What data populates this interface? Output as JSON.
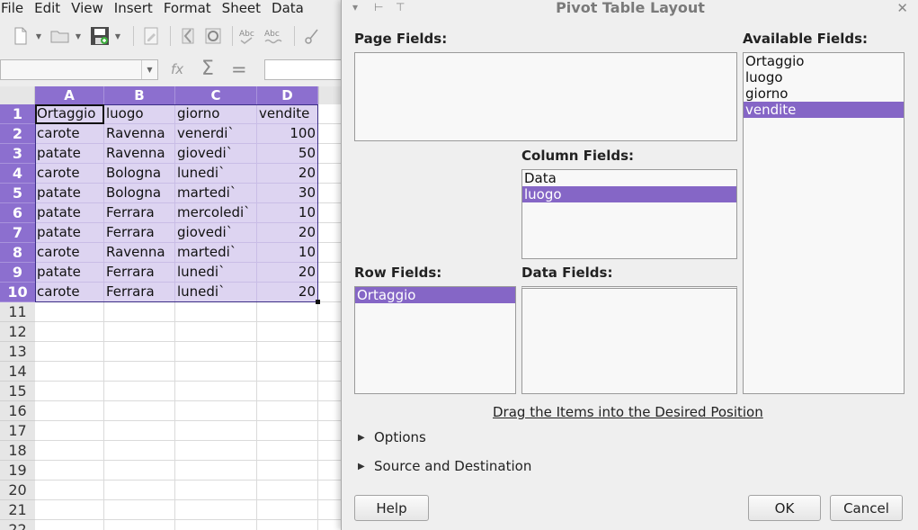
{
  "menubar": {
    "items": [
      "File",
      "Edit",
      "View",
      "Insert",
      "Format",
      "Sheet",
      "Data"
    ]
  },
  "toolbar": {
    "icons": [
      "new-document-icon",
      "open-folder-icon",
      "save-icon",
      "edit-file-icon",
      "export-pdf-icon",
      "print-preview-icon",
      "spellcheck-icon",
      "autospell-icon",
      "cut-icon"
    ]
  },
  "formula_bar": {
    "fx": "fx",
    "sum": "Σ",
    "equals": "="
  },
  "sheet": {
    "columns": [
      "A",
      "B",
      "C",
      "D"
    ],
    "row_numbers": [
      "1",
      "2",
      "3",
      "4",
      "5",
      "6",
      "7",
      "8",
      "9",
      "10",
      "11",
      "12",
      "13",
      "14",
      "15",
      "16",
      "17",
      "18",
      "19",
      "20",
      "21",
      "22"
    ],
    "rows": [
      [
        "Ortaggio",
        "luogo",
        "giorno",
        "vendite"
      ],
      [
        "carote",
        "Ravenna",
        "venerdi`",
        "100"
      ],
      [
        "patate",
        "Ravenna",
        "giovedi`",
        "50"
      ],
      [
        "carote",
        "Bologna",
        "lunedi`",
        "20"
      ],
      [
        "patate",
        "Bologna",
        "martedi`",
        "30"
      ],
      [
        "patate",
        "Ferrara",
        "mercoledi`",
        "10"
      ],
      [
        "patate",
        "Ferrara",
        "giovedi`",
        "20"
      ],
      [
        "carote",
        "Ravenna",
        "martedi`",
        "10"
      ],
      [
        "patate",
        "Ferrara",
        "lunedi`",
        "20"
      ],
      [
        "carote",
        "Ferrara",
        "lunedi`",
        "20"
      ]
    ],
    "selection_color": "#8c6fcf"
  },
  "dialog": {
    "title": "Pivot Table Layout",
    "page_fields_label": "Page Fields:",
    "available_fields_label": "Available Fields:",
    "available_fields": [
      "Ortaggio",
      "luogo",
      "giorno",
      "vendite"
    ],
    "available_selected": "vendite",
    "column_fields_label": "Column Fields:",
    "column_fields": [
      "Data",
      "luogo"
    ],
    "column_selected": "luogo",
    "row_fields_label": "Row Fields:",
    "row_fields": [
      "Ortaggio"
    ],
    "row_selected": "Ortaggio",
    "data_fields_label": "Data Fields:",
    "drag_hint": "Drag the Items into the Desired Position",
    "options_label": "Options",
    "source_label": "Source and Destination",
    "help_label": "Help",
    "ok_label": "OK",
    "cancel_label": "Cancel",
    "accent": "#8566c6"
  }
}
